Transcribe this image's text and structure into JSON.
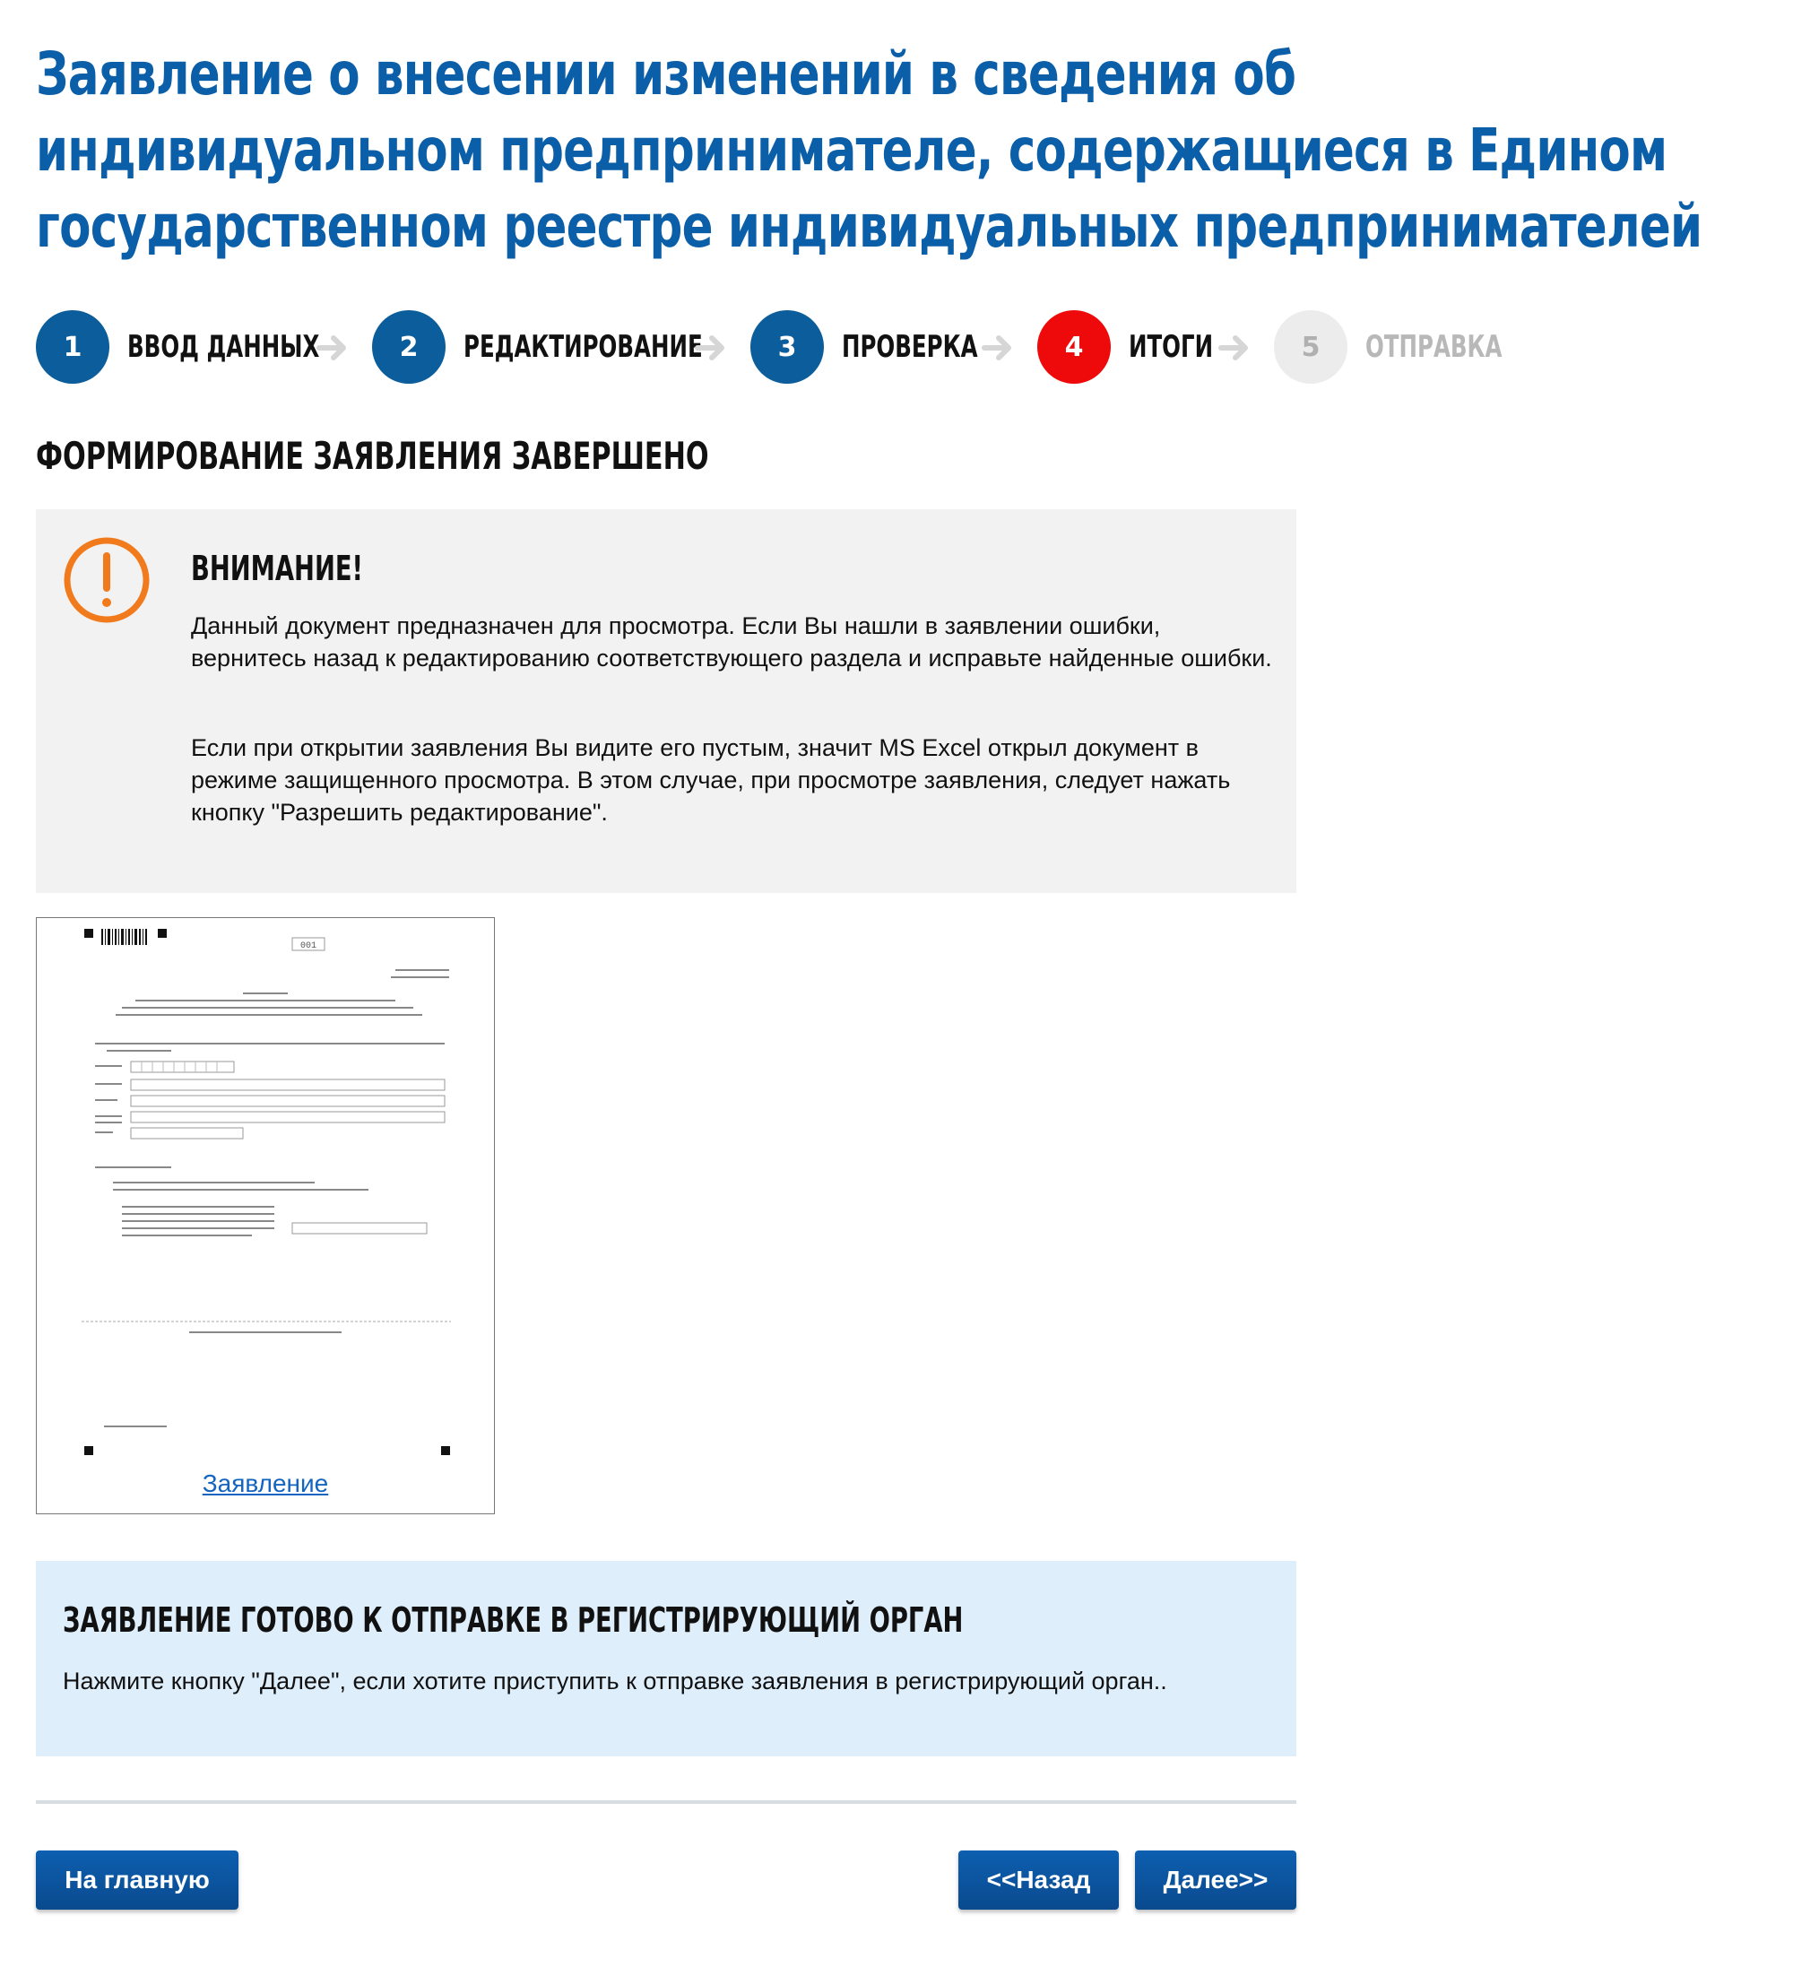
{
  "title": "Заявление о внесении изменений в сведения об индивидуальном предпринимателе, содержащиеся в Едином государственном реестре индивидуальных предпринимателей",
  "steps": [
    {
      "number": "1",
      "label": "ВВОД ДАННЫХ",
      "state": "done"
    },
    {
      "number": "2",
      "label": "РЕДАКТИРОВАНИЕ",
      "state": "done"
    },
    {
      "number": "3",
      "label": "ПРОВЕРКА",
      "state": "done"
    },
    {
      "number": "4",
      "label": "ИТОГИ",
      "state": "active"
    },
    {
      "number": "5",
      "label": "ОТПРАВКА",
      "state": "disabled"
    }
  ],
  "section_heading": "ФОРМИРОВАНИЕ ЗАЯВЛЕНИЯ ЗАВЕРШЕНО",
  "warning": {
    "icon": "exclamation-circle-icon",
    "title": "ВНИМАНИЕ!",
    "paragraph1": "Данный документ предназначен для просмотра. Если Вы нашли в заявлении ошибки, вернитесь назад к редактированию соответствующего раздела и исправьте найденные ошибки.",
    "paragraph2": "Если при открытии заявления Вы видите его пустым, значит MS Excel открыл документ в режиме защищенного просмотра. В этом случае, при просмотре заявления, следует нажать кнопку \"Разрешить редактирование\"."
  },
  "document": {
    "link_label": "Заявление",
    "page_number": "001"
  },
  "ready": {
    "title": "ЗАЯВЛЕНИЕ ГОТОВО К ОТПРАВКЕ В РЕГИСТРИРУЮЩИЙ ОРГАН",
    "text": "Нажмите кнопку \"Далее\", если хотите приступить к отправке заявления в регистрирующий орган.."
  },
  "buttons": {
    "home": "На главную",
    "back": "<<Назад",
    "next": "Далее>>"
  },
  "colors": {
    "title_blue": "#0b5ea8",
    "step_blue": "#0b5e9b",
    "step_active": "#ee0a0a",
    "warning_orange": "#f07a1c",
    "info_bg": "#dfeefb"
  }
}
